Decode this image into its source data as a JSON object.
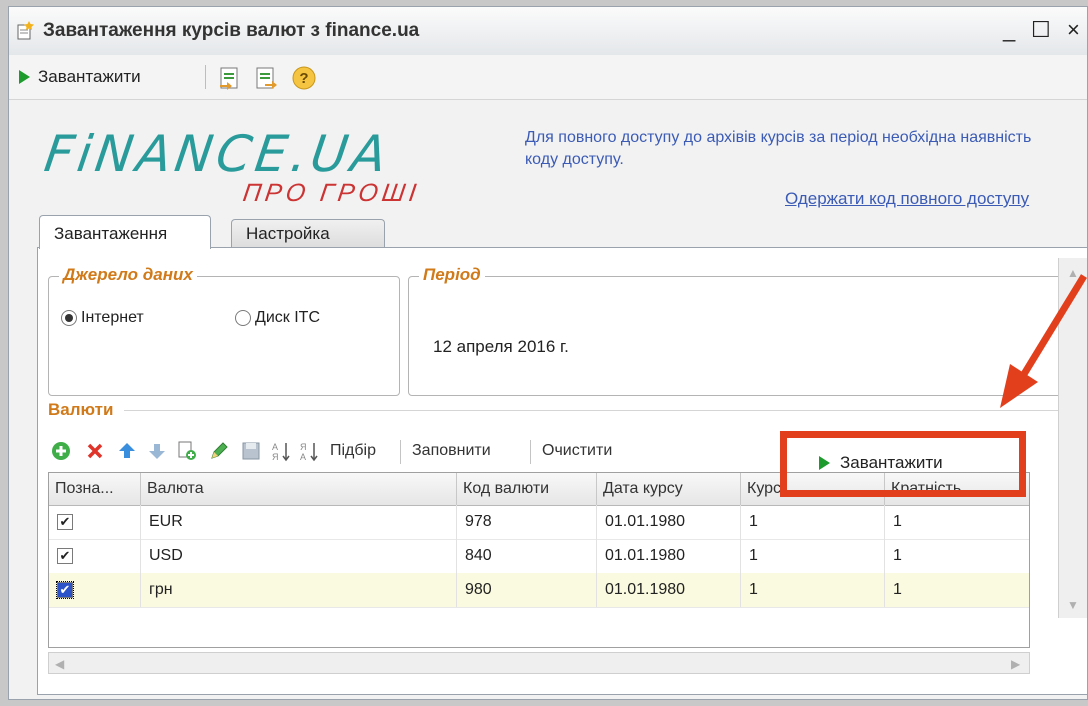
{
  "window": {
    "title": "Завантаження курсів валют з finance.ua",
    "minimize": "_",
    "maximize": "☐",
    "close": "×"
  },
  "toolbar": {
    "load_label": "Завантажити",
    "help_label": "?"
  },
  "logo": {
    "main": "FiNANCE.UA",
    "sub": "ПРО ГРОШІ"
  },
  "info": {
    "text": "Для повного доступу до архівів курсів за період необхідна наявність коду доступу.",
    "link": "Одержати код повного доступу"
  },
  "tabs": [
    {
      "label": "Завантаження",
      "active": true
    },
    {
      "label": "Настройка",
      "active": false
    }
  ],
  "source_group": {
    "title": "Джерело даних",
    "options": [
      {
        "label": "Інтернет",
        "selected": true
      },
      {
        "label": "Диск ІТС",
        "selected": false
      }
    ]
  },
  "period_group": {
    "title": "Період",
    "value": "12 апреля 2016 г."
  },
  "currencies": {
    "title": "Валюти",
    "toolbar": {
      "pick": "Підбір",
      "fill": "Заповнити",
      "clear": "Очистити",
      "load": "Завантажити"
    },
    "columns": [
      "Позна...",
      "Валюта",
      "Код валюти",
      "Дата курсу",
      "Курс",
      "Кратність"
    ],
    "rows": [
      {
        "mark": true,
        "currency": "EUR",
        "code": "978",
        "date": "01.01.1980",
        "rate": "1",
        "multiplicity": "1"
      },
      {
        "mark": true,
        "currency": "USD",
        "code": "840",
        "date": "01.01.1980",
        "rate": "1",
        "multiplicity": "1"
      },
      {
        "mark": true,
        "currency": "грн",
        "code": "980",
        "date": "01.01.1980",
        "rate": "1",
        "multiplicity": "1"
      }
    ]
  },
  "colors": {
    "accent_orange": "#d07a1a",
    "logo_teal": "#2a9b9b",
    "logo_red": "#cc3333",
    "highlight_red": "#e2401d",
    "link_blue": "#3b5bb5"
  }
}
